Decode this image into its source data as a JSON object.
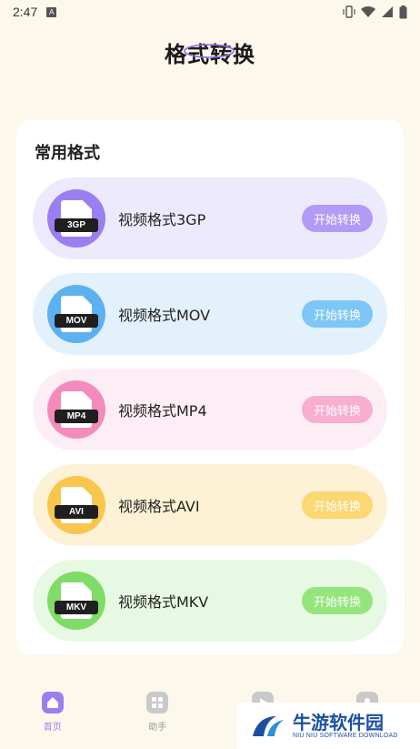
{
  "status_bar": {
    "time": "2:47",
    "notif_letter": "A"
  },
  "header": {
    "title": "格式转换"
  },
  "section": {
    "title": "常用格式"
  },
  "formats": [
    {
      "tag": "3GP",
      "label": "视频格式3GP",
      "button": "开始转换",
      "row_bg": "#eeeafd",
      "circle": "#9b7ff0",
      "btn": "#b39af6"
    },
    {
      "tag": "MOV",
      "label": "视频格式MOV",
      "button": "开始转换",
      "row_bg": "#e3f1fd",
      "circle": "#5eb1f0",
      "btn": "#7dc6f5"
    },
    {
      "tag": "MP4",
      "label": "视频格式MP4",
      "button": "开始转换",
      "row_bg": "#fdeef5",
      "circle": "#f38bbd",
      "btn": "#f8aed0"
    },
    {
      "tag": "AVI",
      "label": "视频格式AVI",
      "button": "开始转换",
      "row_bg": "#fdf1d6",
      "circle": "#f8c64d",
      "btn": "#fbd872"
    },
    {
      "tag": "MKV",
      "label": "视频格式MKV",
      "button": "开始转换",
      "row_bg": "#e8f9e3",
      "circle": "#7edc67",
      "btn": "#95e57d"
    }
  ],
  "nav": [
    {
      "label": "首页",
      "icon": "home-icon",
      "active": true
    },
    {
      "label": "助手",
      "icon": "grid-icon",
      "active": false
    },
    {
      "label": "",
      "icon": "play-icon",
      "active": false
    },
    {
      "label": "",
      "icon": "user-icon",
      "active": false
    }
  ],
  "watermark": {
    "main": "牛游软件园",
    "sub": "NIU NIU SOFTWARE DOWNLOAD"
  },
  "colors": {
    "background": "#fdf8ec",
    "card": "#ffffff",
    "nav_active": "#9b7ff0",
    "nav_inactive": "#c9c9c9"
  }
}
